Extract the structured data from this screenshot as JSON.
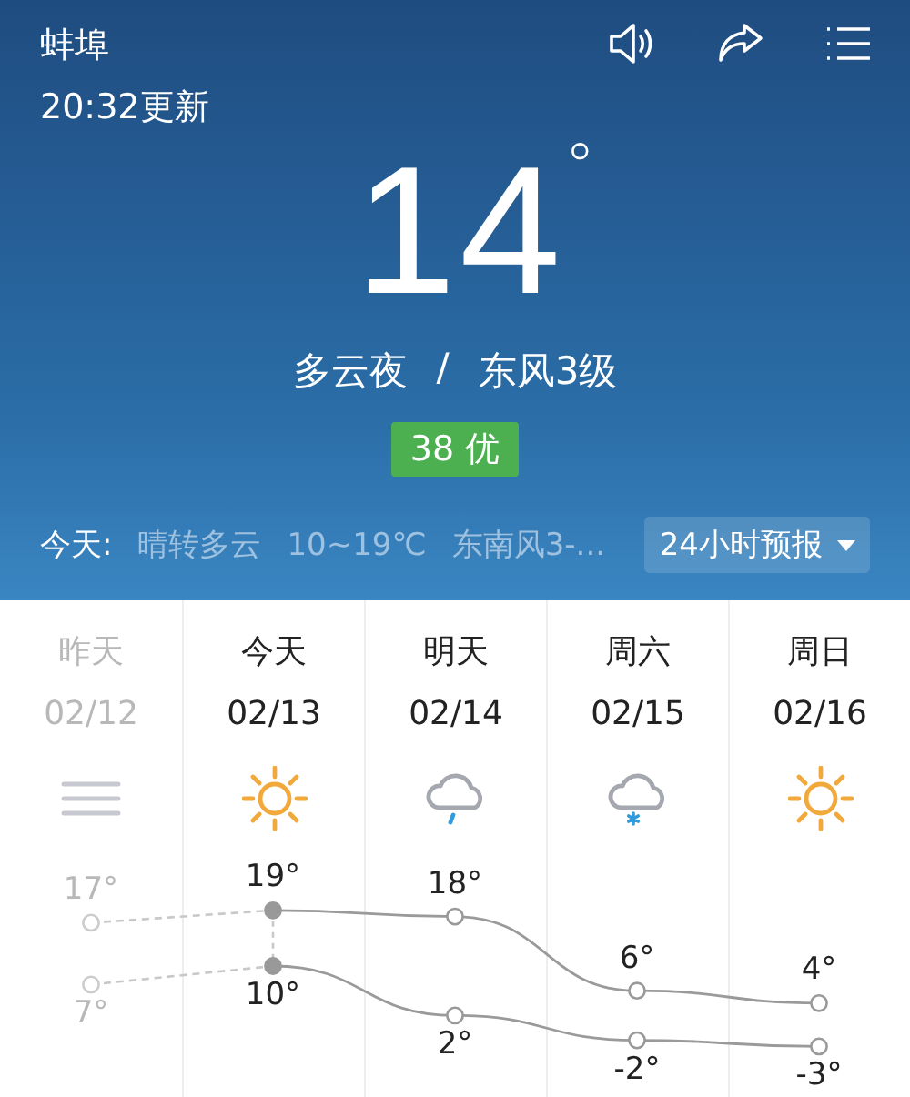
{
  "header": {
    "city": "蚌埠",
    "updated": "20:32更新"
  },
  "current": {
    "temperature": "14",
    "degree": "°",
    "condition": "多云夜",
    "separator": "/",
    "wind": "东风3级",
    "aqi": "38 优"
  },
  "today_bar": {
    "label": "今天:",
    "condition": "晴转多云",
    "temps": "10~19℃",
    "wind": "东南风3-...",
    "forecast_button": "24小时预报"
  },
  "days": [
    {
      "name": "昨天",
      "date": "02/12",
      "kind": "haze",
      "past": true,
      "high": "17°",
      "low": "7°"
    },
    {
      "name": "今天",
      "date": "02/13",
      "kind": "sunny",
      "past": false,
      "high": "19°",
      "low": "10°"
    },
    {
      "name": "明天",
      "date": "02/14",
      "kind": "rain",
      "past": false,
      "high": "18°",
      "low": "2°"
    },
    {
      "name": "周六",
      "date": "02/15",
      "kind": "snow",
      "past": false,
      "high": "6°",
      "low": "-2°"
    },
    {
      "name": "周日",
      "date": "02/16",
      "kind": "sunny",
      "past": false,
      "high": "4°",
      "low": "-3°"
    }
  ]
}
